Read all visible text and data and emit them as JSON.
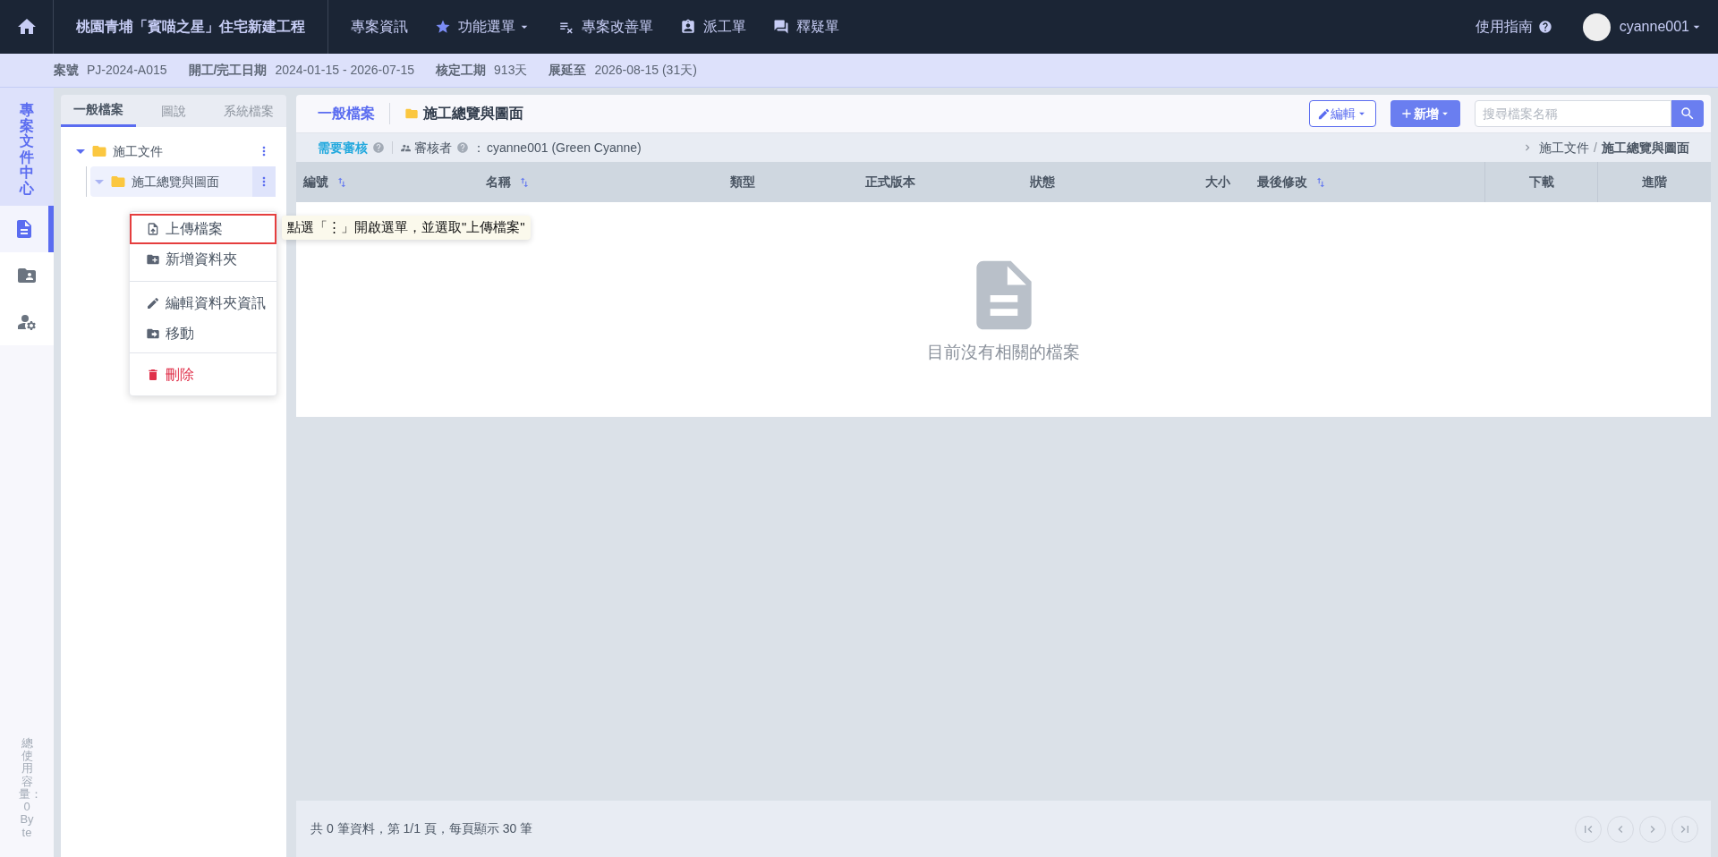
{
  "top_bar": {
    "project_title": "桃園青埔「賓喵之星」住宅新建工程",
    "nav": [
      {
        "kind": "plain",
        "label": "專案資訊"
      },
      {
        "kind": "star-menu",
        "label": "功能選單"
      },
      {
        "kind": "checklist",
        "label": "專案改善單"
      },
      {
        "kind": "badge",
        "label": "派工單"
      },
      {
        "kind": "chat",
        "label": "釋疑單"
      }
    ],
    "guide": "使用指南",
    "user": "cyanne001"
  },
  "info_bar": [
    {
      "label": "案號",
      "value": "PJ-2024-A015"
    },
    {
      "label": "開工/完工日期",
      "value": "2024-01-15 - 2026-07-15"
    },
    {
      "label": "核定工期",
      "value": "913天"
    },
    {
      "label": "展延至",
      "value": "2026-08-15 (31天)"
    }
  ],
  "side_rail": {
    "title": "專案文件中心",
    "items": [
      {
        "kind": "document",
        "selected": true
      },
      {
        "kind": "shared-folder",
        "selected": false
      },
      {
        "kind": "user-settings",
        "selected": false
      }
    ],
    "usage": "總使用容量：0 Byte"
  },
  "tree_panel": {
    "tabs": [
      {
        "label": "一般檔案",
        "selected": true
      },
      {
        "label": "圖說",
        "selected": false
      },
      {
        "label": "系統檔案",
        "selected": false
      }
    ],
    "tree": [
      {
        "label": "施工文件",
        "expanded": true,
        "selected": false,
        "children": [
          {
            "label": "施工總覽與圖面",
            "expanded": true,
            "selected": true
          }
        ]
      }
    ]
  },
  "context_menu": {
    "groups": [
      [
        {
          "kind": "upload",
          "label": "上傳檔案",
          "highlighted": true
        },
        {
          "kind": "new-folder",
          "label": "新增資料夾",
          "highlighted": false
        }
      ],
      [
        {
          "kind": "edit",
          "label": "編輯資料夾資訊",
          "highlighted": false
        },
        {
          "kind": "move",
          "label": "移動",
          "highlighted": false
        }
      ],
      [
        {
          "kind": "delete",
          "label": "刪除",
          "highlighted": false
        }
      ]
    ]
  },
  "tooltip": "點選「⋮」開啟選單，並選取\"上傳檔案\"",
  "main": {
    "tab": "一般檔案",
    "folder": "施工總覽與圖面",
    "edit_button": "編輯",
    "add_button": "新增",
    "search": {
      "placeholder": "搜尋檔案名稱"
    },
    "review": {
      "label": "需要審核",
      "reviewer_label": "審核者",
      "separator": "：",
      "reviewer": "cyanne001 (Green Cyanne)"
    },
    "breadcrumb": [
      "施工文件",
      "施工總覽與圖面"
    ],
    "breadcrumb_separator": "/",
    "columns": [
      {
        "label": "編號",
        "sortable": true
      },
      {
        "label": "名稱",
        "sortable": true
      },
      {
        "label": "類型",
        "sortable": false
      },
      {
        "label": "正式版本",
        "sortable": false
      },
      {
        "label": "狀態",
        "sortable": false
      },
      {
        "label": "大小",
        "sortable": false
      },
      {
        "label": "最後修改",
        "sortable": true
      },
      {
        "label": "下載",
        "sortable": false
      },
      {
        "label": "進階",
        "sortable": false
      }
    ],
    "empty_message": "目前沒有相關的檔案",
    "footer": "共 0 筆資料，第 1/1 頁，每頁顯示 30 筆",
    "pagination": [
      {
        "kind": "first",
        "disabled": true
      },
      {
        "kind": "prev",
        "disabled": true
      },
      {
        "kind": "next",
        "disabled": true
      },
      {
        "kind": "last",
        "disabled": true
      }
    ]
  }
}
